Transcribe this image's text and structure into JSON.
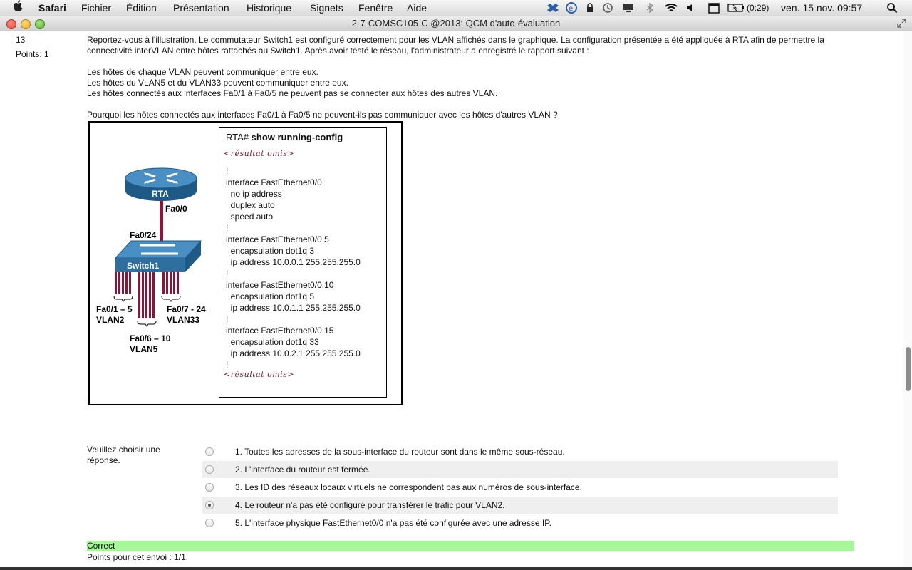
{
  "menubar": {
    "app": "Safari",
    "items": [
      "Fichier",
      "Édition",
      "Présentation",
      "Historique",
      "Signets",
      "Fenêtre",
      "Aide"
    ],
    "battery": "(0:29)",
    "datetime": "ven. 15 nov.  09:57",
    "icons": [
      "apple-icon",
      "dropbox-icon",
      "evernote-icon",
      "vpn-icon",
      "time-machine-icon",
      "display-icon",
      "bluetooth-icon",
      "wifi-icon",
      "volume-icon",
      "calendar-icon",
      "battery-icon",
      "spotlight-icon"
    ]
  },
  "window": {
    "title": "2-7-COMSC105-C @2013: QCM d'auto-évaluation"
  },
  "question": {
    "number": "13",
    "points": "Points: 1",
    "intro": "Reportez-vous à l'illustration. Le commutateur Switch1 est configuré correctement pour les VLAN affichés dans le graphique. La configuration présentée a été appliquée à RTA afin de permettre la connectivité interVLAN entre hôtes rattachés au Switch1. Après avoir testé le réseau, l'administrateur a enregistré le rapport suivant :",
    "report": [
      "Les hôtes de chaque VLAN peuvent communiquer entre eux.",
      "Les hôtes du VLAN5 et du VLAN33 peuvent communiquer entre eux.",
      "Les hôtes connectés aux interfaces Fa0/1 à Fa0/5 ne peuvent pas se connecter aux hôtes des autres VLAN."
    ],
    "prompt": "Pourquoi les hôtes connectés aux interfaces Fa0/1 à Fa0/5 ne peuvent-ils pas communiquer avec les hôtes d'autres VLAN ?"
  },
  "figure": {
    "router_label": "RTA",
    "router_port": "Fa0/0",
    "switch_uplink": "Fa0/24",
    "switch_label": "Switch1",
    "group1_ports": "Fa0/1 – 5",
    "group1_vlan": "VLAN2",
    "group2_ports": "Fa0/6 – 10",
    "group2_vlan": "VLAN5",
    "group3_ports": "Fa0/7 - 24",
    "group3_vlan": "VLAN33",
    "config_prompt": "RTA# ",
    "config_command": "show running-config",
    "omitted": "<résultat omis>",
    "config_lines": [
      "!",
      "interface FastEthernet0/0",
      "  no ip address",
      "  duplex auto",
      "  speed auto",
      "!",
      "interface FastEthernet0/0.5",
      "  encapsulation dot1q 3",
      "  ip address 10.0.0.1 255.255.255.0",
      "!",
      "interface FastEthernet0/0.10",
      "  encapsulation dot1q 5",
      "  ip address 10.0.1.1 255.255.255.0",
      "!",
      "interface FastEthernet0/0.15",
      "  encapsulation dot1q 33",
      "  ip address 10.0.2.1 255.255.255.0",
      "!"
    ]
  },
  "answers": {
    "prompt": "Veuillez choisir une réponse.",
    "options": [
      "1. Toutes les adresses de la sous-interface du routeur sont dans le même sous-réseau.",
      "2. L'interface du routeur est fermée.",
      "3. Les ID des réseaux locaux virtuels ne correspondent pas aux numéros de sous-interface.",
      "4. Le routeur n'a pas été configuré pour transférer le trafic pour VLAN2.",
      "5. L'interface physique FastEthernet0/0 n'a pas été configurée avec une adresse IP."
    ],
    "selected": 4
  },
  "feedback": {
    "status": "Correct",
    "points": "Points pour cet envoi : 1/1."
  },
  "colors": {
    "router": "#2f6f9f",
    "link": "#8a1538",
    "correct_bg": "#a9f59c"
  }
}
